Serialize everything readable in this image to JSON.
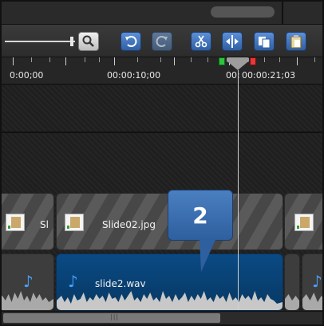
{
  "toolbar": {
    "buttons": [
      {
        "name": "zoom-button",
        "icon": "magnifier-icon"
      },
      {
        "name": "undo-button",
        "icon": "undo-icon"
      },
      {
        "name": "redo-button",
        "icon": "redo-icon"
      },
      {
        "name": "cut-button",
        "icon": "scissors-icon"
      },
      {
        "name": "split-button",
        "icon": "split-icon"
      },
      {
        "name": "copy-button",
        "icon": "copy-icon"
      },
      {
        "name": "paste-button",
        "icon": "paste-icon"
      }
    ],
    "colors": {
      "button_blue": "#2f5fa3",
      "button_light": "#f0f0f0"
    }
  },
  "ruler": {
    "labels": [
      "0:00;00",
      "00:00:10;00",
      "00;"
    ],
    "playhead_time": "00:00:21;03",
    "colors": {
      "in_marker": "#2cc63a",
      "out_marker": "#e03a3a"
    }
  },
  "tracks": {
    "image_clips": [
      {
        "label": "Sl"
      },
      {
        "label": "Slide02.jpg"
      }
    ],
    "audio_clips": [
      {
        "label": ""
      },
      {
        "label": "slide2.wav",
        "selected": true
      }
    ],
    "icons": {
      "audio": "music-note-icon",
      "image": "slide-thumbnail-icon"
    }
  },
  "callout": {
    "number": "2",
    "color": "#2e5f9f"
  },
  "scrollbar": {
    "grip": "|||"
  }
}
